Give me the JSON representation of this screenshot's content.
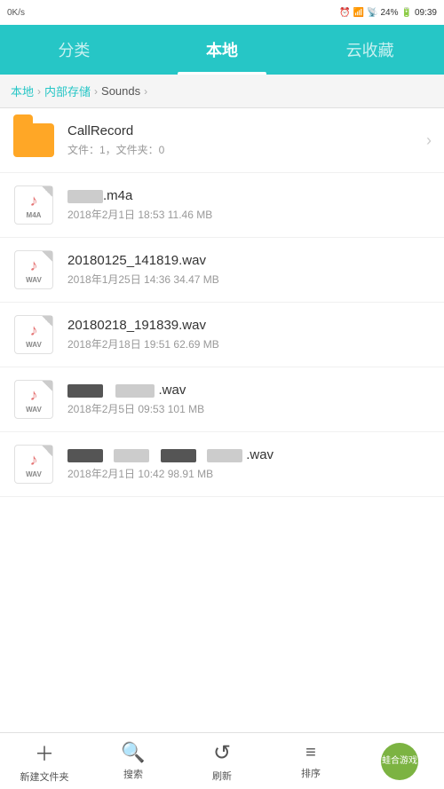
{
  "statusBar": {
    "left": "0K/s",
    "time": "09:39",
    "battery": "24%",
    "signal": "46/26"
  },
  "nav": {
    "tabs": [
      {
        "id": "classify",
        "label": "分类",
        "active": false
      },
      {
        "id": "local",
        "label": "本地",
        "active": true
      },
      {
        "id": "cloud",
        "label": "云收藏",
        "active": false
      }
    ]
  },
  "breadcrumb": {
    "items": [
      {
        "label": "本地",
        "link": true
      },
      {
        "label": "内部存储",
        "link": true
      },
      {
        "label": "Sounds",
        "link": false
      }
    ]
  },
  "files": [
    {
      "id": "callrecord",
      "type": "folder",
      "name": "CallRecord",
      "meta": "文件：1，文件夹：0",
      "hasArrow": true
    },
    {
      "id": "file1",
      "type": "audio",
      "ext": "M4A",
      "namePrefix": "[blurred]",
      "nameSuffix": ".m4a",
      "meta": "2018年2月1日 18:53 11.46 MB",
      "hasArrow": false
    },
    {
      "id": "file2",
      "type": "audio",
      "ext": "WAV",
      "namePrefix": "",
      "name": "20180125_141819.wav",
      "meta": "2018年1月25日 14:36 34.47 MB",
      "hasArrow": false
    },
    {
      "id": "file3",
      "type": "audio",
      "ext": "WAV",
      "namePrefix": "",
      "name": "20180218_191839.wav",
      "meta": "2018年2月18日 19:51 62.69 MB",
      "hasArrow": false
    },
    {
      "id": "file4",
      "type": "audio",
      "ext": "WAV",
      "namePrefix": "[blurred]",
      "nameSuffix": ".wav",
      "meta": "2018年2月5日 09:53 101 MB",
      "hasArrow": false
    },
    {
      "id": "file5",
      "type": "audio",
      "ext": "WAV",
      "namePrefix": "[blurred2]",
      "nameSuffix": ".wav",
      "meta": "2018年2月1日 10:42 98.91 MB",
      "hasArrow": false
    }
  ],
  "bottomBar": {
    "buttons": [
      {
        "id": "new-folder",
        "icon": "+",
        "label": "新建文件夹"
      },
      {
        "id": "search",
        "icon": "🔍",
        "label": "搜索"
      },
      {
        "id": "refresh",
        "icon": "↺",
        "label": "刷新"
      },
      {
        "id": "sort",
        "icon": "≡",
        "label": "排序"
      },
      {
        "id": "frog",
        "label": "蛙合游戏"
      }
    ]
  }
}
